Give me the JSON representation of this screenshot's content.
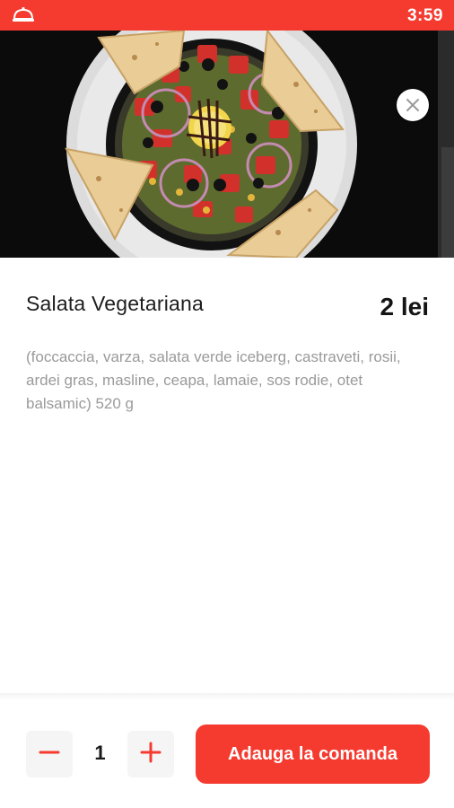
{
  "status_bar": {
    "time": "3:59",
    "app_icon": "food-cloche-icon",
    "background_color": "#f53b30"
  },
  "hero": {
    "image": "salad-plate-with-flatbread-photo",
    "close_icon": "close-icon"
  },
  "product": {
    "name": "Salata Vegetariana",
    "price": "2 lei",
    "description": "(foccaccia, varza, salata verde iceberg, castraveti, rosii, ardei gras, masline, ceapa, lamaie, sos rodie, otet balsamic) 520 g"
  },
  "order_bar": {
    "minus_icon": "minus-icon",
    "plus_icon": "plus-icon",
    "quantity": "1",
    "add_button_label": "Adauga la comanda",
    "accent_color": "#f53b30"
  }
}
